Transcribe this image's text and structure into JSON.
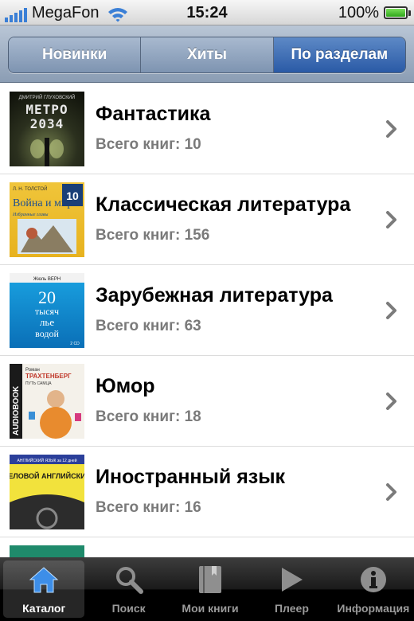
{
  "status_bar": {
    "carrier": "MegaFon",
    "time": "15:24",
    "battery": "100%",
    "battery_level": 1.0,
    "signal_bars": 5
  },
  "segments": [
    {
      "label": "Новинки",
      "active": false
    },
    {
      "label": "Хиты",
      "active": false
    },
    {
      "label": "По разделам",
      "active": true
    }
  ],
  "categories": [
    {
      "title": "Фантастика",
      "count_text": "Всего книг: 10",
      "cover": "metro-2034-cover"
    },
    {
      "title": "Классическая литература",
      "count_text": "Всего книг: 156",
      "cover": "war-and-peace-cover"
    },
    {
      "title": "Зарубежная литература",
      "count_text": "Всего книг: 63",
      "cover": "twenty-thousand-leagues-cover"
    },
    {
      "title": "Юмор",
      "count_text": "Всего книг: 18",
      "cover": "audiobook-humor-cover"
    },
    {
      "title": "Иностранный язык",
      "count_text": "Всего книг: 16",
      "cover": "english-language-cover"
    }
  ],
  "cover_text": {
    "metro_top": "ДМИТРИЙ ГЛУХОВСКИЙ",
    "metro_title": "МЕТРО",
    "metro_year": "2034",
    "war_author": "Л. Н. ТОЛСТОЙ",
    "war_title": "Война и мир",
    "war_sub": "Избранные главы",
    "war_num": "10",
    "jv_author": "Жюль ВЕРН",
    "jv_num": "20",
    "jv_line1": "тысяч",
    "jv_line2": "лье",
    "jv_line3": "водой",
    "jv_cd": "2 CD",
    "hum_side": "AUDIOBOOK",
    "hum_author": "Роман",
    "hum_name": "ТРАХТЕНБЕРГ",
    "hum_title": "ПУТЬ САМЦА",
    "eng_top": "АНГЛИЙСКИЙ ЯЗЫК за 12 дней",
    "eng_title": "БЕЛОВОЙ АНГЛИЙСКИЙ"
  },
  "tabs": [
    {
      "label": "Каталог",
      "icon": "house-icon",
      "active": true
    },
    {
      "label": "Поиск",
      "icon": "magnifier-icon",
      "active": false
    },
    {
      "label": "Мои книги",
      "icon": "book-icon",
      "active": false
    },
    {
      "label": "Плеер",
      "icon": "play-icon",
      "active": false
    },
    {
      "label": "Информация",
      "icon": "info-icon",
      "active": false
    }
  ],
  "colors": {
    "segment_active": "#3a6bb4",
    "tab_active_icon": "#3d8ee8",
    "subtitle_gray": "#7a7a7a"
  }
}
